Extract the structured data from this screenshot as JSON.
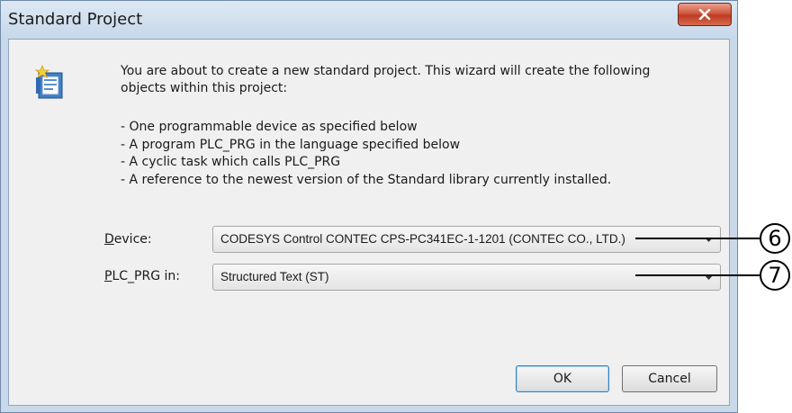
{
  "window": {
    "title": "Standard Project",
    "close_icon": "close-x-icon",
    "close_color": "#c8412a"
  },
  "intro": {
    "icon": "wizard-new-project-icon",
    "text": "You are about to create a new standard project. This wizard will create the following objects within this project:"
  },
  "bullets": [
    "- One programmable device as specified below",
    "- A program PLC_PRG in the language specified below",
    "- A cyclic task which calls PLC_PRG",
    "- A reference to the newest version of the Standard library currently installed."
  ],
  "device": {
    "label": "Device:",
    "value": "CODESYS Control CONTEC CPS-PC341EC-1-1201 (CONTEC CO., LTD.)"
  },
  "language": {
    "label": "PLC_PRG in:",
    "value": "Structured Text (ST)"
  },
  "buttons": {
    "ok": "OK",
    "cancel": "Cancel"
  },
  "callouts": [
    "6",
    "7"
  ]
}
